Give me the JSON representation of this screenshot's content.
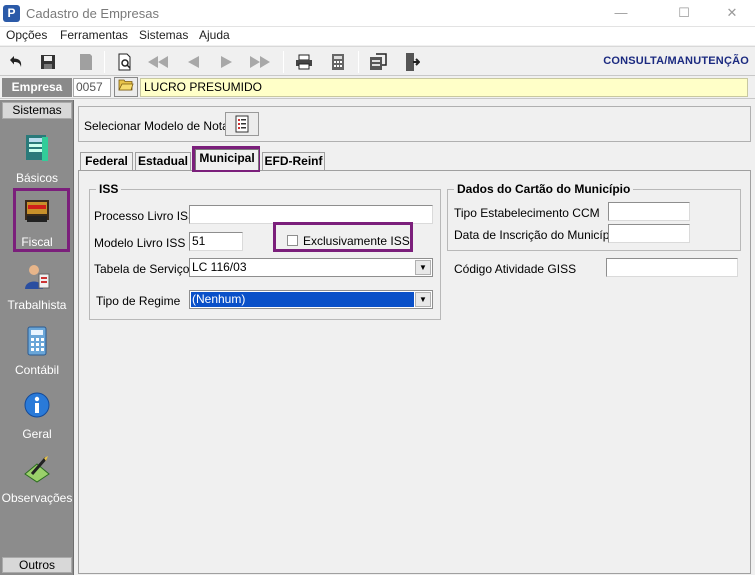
{
  "window": {
    "title": "Cadastro de Empresas",
    "icon_letter": "P",
    "controls": {
      "minimize": "—",
      "maximize": "☐",
      "close": "✕"
    }
  },
  "menu": [
    "Opções",
    "Ferramentas",
    "Sistemas",
    "Ajuda"
  ],
  "toolbar": {
    "mode_label": "CONSULTA/MANUTENÇÃO",
    "icons": [
      "undo-icon",
      "save-icon",
      "bookmark-icon",
      "preview-icon",
      "first-record-icon",
      "previous-record-icon",
      "next-record-icon",
      "last-record-icon",
      "print-icon",
      "calculator-icon",
      "settings-icon",
      "exit-icon"
    ]
  },
  "empresa": {
    "label": "Empresa",
    "code": "0057",
    "name": "LUCRO PRESUMIDO"
  },
  "sidebar": {
    "header": "Sistemas",
    "footer": "Outros",
    "items": [
      {
        "label": "Básicos",
        "icon": "basicos-icon"
      },
      {
        "label": "Fiscal",
        "icon": "fiscal-icon"
      },
      {
        "label": "Trabalhista",
        "icon": "trabalhista-icon"
      },
      {
        "label": "Contábil",
        "icon": "calculator-icon"
      },
      {
        "label": "Geral",
        "icon": "info-icon"
      },
      {
        "label": "Observações",
        "icon": "notes-icon"
      }
    ]
  },
  "modelo_nota": {
    "label": "Selecionar Modelo de Nota"
  },
  "tabs": [
    {
      "label": "Federal",
      "active": false
    },
    {
      "label": "Estadual",
      "active": false
    },
    {
      "label": "Municipal",
      "active": true
    },
    {
      "label": "EFD-Reinf",
      "active": false
    }
  ],
  "iss": {
    "title": "ISS",
    "processo_livro_label": "Processo Livro ISS",
    "processo_livro_value": "",
    "modelo_livro_label": "Modelo Livro ISS",
    "modelo_livro_value": "51",
    "exclusivamente_label": "Exclusivamente ISS",
    "exclusivamente_checked": false,
    "tabela_servicos_label": "Tabela de Serviços",
    "tabela_servicos_value": "LC 116/03",
    "tipo_regime_label": "Tipo de Regime",
    "tipo_regime_value": "(Nenhum)"
  },
  "cartao": {
    "title": "Dados do Cartão do Município",
    "tipo_estab_label": "Tipo Estabelecimento CCM",
    "tipo_estab_value": "",
    "data_inscricao_label": "Data de Inscrição do Município",
    "data_inscricao_value": ""
  },
  "giss": {
    "label": "Código Atividade GISS",
    "value": ""
  },
  "colors": {
    "highlight": "#7b1f7b",
    "selection": "#0a50c8",
    "mode_label": "#1b2a80",
    "empresa_name_bg": "#ffffc8"
  }
}
